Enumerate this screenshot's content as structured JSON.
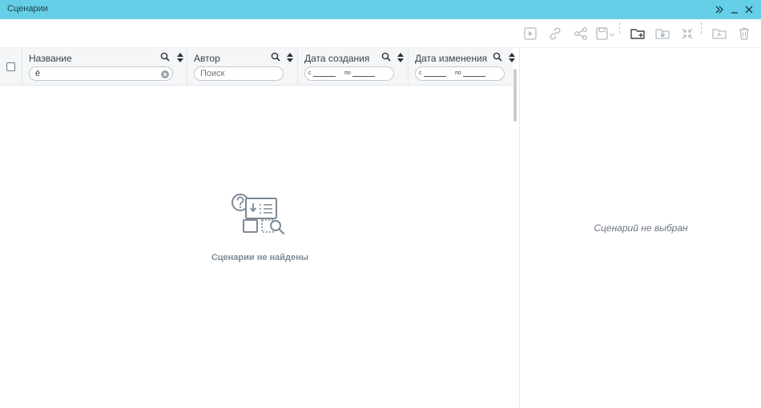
{
  "window": {
    "title": "Сценарии"
  },
  "toolbar": {
    "icons": [
      "play-icon",
      "link-icon",
      "share-icon",
      "save-icon",
      "new-folder-icon",
      "lock-folder-icon",
      "collapse-icon",
      "open-folder-icon",
      "trash-icon"
    ]
  },
  "table": {
    "columns": [
      {
        "label": "Название",
        "filter_value": "ё",
        "filter_placeholder": ""
      },
      {
        "label": "Автор",
        "filter_value": "",
        "filter_placeholder": "Поиск"
      },
      {
        "label": "Дата создания",
        "from_label": "с",
        "to_label": "по"
      },
      {
        "label": "Дата изменения",
        "from_label": "с",
        "to_label": "по"
      }
    ],
    "empty_message": "Сценарии не найдены"
  },
  "details": {
    "empty_message": "Сценарий не выбран"
  },
  "colors": {
    "titlebar": "#64cfe6",
    "icon_gray": "#a9b3bb",
    "active_icon": "#3c454d"
  }
}
